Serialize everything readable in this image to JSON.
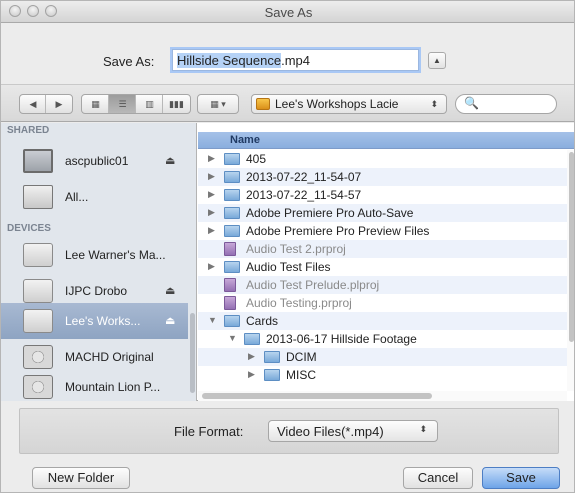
{
  "window": {
    "title": "Save As"
  },
  "save_as": {
    "label": "Save As:",
    "filename_selected": "Hillside Sequence",
    "filename_ext": ".mp4",
    "expand_glyph": "▲"
  },
  "toolbar": {
    "back_glyph": "◀",
    "forward_glyph": "▶",
    "view_icon_glyph": "▦",
    "view_list_glyph": "☰",
    "view_column_glyph": "▥",
    "view_coverflow_glyph": "▮▮▮",
    "arrange_glyph": "▦ ▾",
    "location": "Lee's Workshops Lacie",
    "location_arrows": "⬍",
    "search_glyph": "🔍"
  },
  "sidebar": {
    "sections": [
      {
        "heading": "SHARED"
      },
      {
        "heading": "DEVICES"
      }
    ],
    "shared_items": [
      {
        "label": "ascpublic01",
        "eject": "⏏",
        "icon": "monitor-icon"
      },
      {
        "label": "All...",
        "icon": "network-icon"
      }
    ],
    "device_items": [
      {
        "label": "Lee Warner's Ma...",
        "icon": "disk-icon"
      },
      {
        "label": "IJPC Drobo",
        "eject": "⏏",
        "icon": "external-drive-icon"
      },
      {
        "label": "Lee's Works...",
        "eject": "⏏",
        "icon": "external-drive-icon",
        "selected": true
      },
      {
        "label": "MACHD Original",
        "icon": "hard-drive-icon"
      },
      {
        "label": "Mountain Lion P...",
        "icon": "hard-drive-icon"
      }
    ]
  },
  "filelist": {
    "column_name": "Name",
    "rows": [
      {
        "name": "405",
        "type": "folder",
        "depth": 0,
        "disclosure": "▶",
        "dim": false
      },
      {
        "name": "2013-07-22_11-54-07",
        "type": "folder",
        "depth": 0,
        "disclosure": "▶",
        "dim": false
      },
      {
        "name": "2013-07-22_11-54-57",
        "type": "folder",
        "depth": 0,
        "disclosure": "▶",
        "dim": false
      },
      {
        "name": "Adobe Premiere Pro Auto-Save",
        "type": "folder",
        "depth": 0,
        "disclosure": "▶",
        "dim": false
      },
      {
        "name": "Adobe Premiere Pro Preview Files",
        "type": "folder",
        "depth": 0,
        "disclosure": "▶",
        "dim": false
      },
      {
        "name": "Audio Test 2.prproj",
        "type": "file",
        "depth": 0,
        "disclosure": "",
        "dim": true
      },
      {
        "name": "Audio Test Files",
        "type": "folder",
        "depth": 0,
        "disclosure": "▶",
        "dim": false
      },
      {
        "name": "Audio Test Prelude.plproj",
        "type": "file",
        "depth": 0,
        "disclosure": "",
        "dim": true
      },
      {
        "name": "Audio Testing.prproj",
        "type": "file",
        "depth": 0,
        "disclosure": "",
        "dim": true
      },
      {
        "name": "Cards",
        "type": "folder",
        "depth": 0,
        "disclosure": "▼",
        "dim": false
      },
      {
        "name": "2013-06-17 Hillside Footage",
        "type": "folder",
        "depth": 1,
        "disclosure": "▼",
        "dim": false
      },
      {
        "name": "DCIM",
        "type": "folder",
        "depth": 2,
        "disclosure": "▶",
        "dim": false
      },
      {
        "name": "MISC",
        "type": "folder",
        "depth": 2,
        "disclosure": "▶",
        "dim": false
      }
    ]
  },
  "accessory": {
    "format_label": "File Format:",
    "format_value": "Video Files(*.mp4)",
    "format_arrows": "⬍"
  },
  "buttons": {
    "new_folder": "New Folder",
    "cancel": "Cancel",
    "save": "Save"
  },
  "colors": {
    "selection": "#b5d2f6",
    "header": "#8aaede",
    "sidebar_selected": "#8ea4c2",
    "default_button": "#6ea4e8"
  }
}
